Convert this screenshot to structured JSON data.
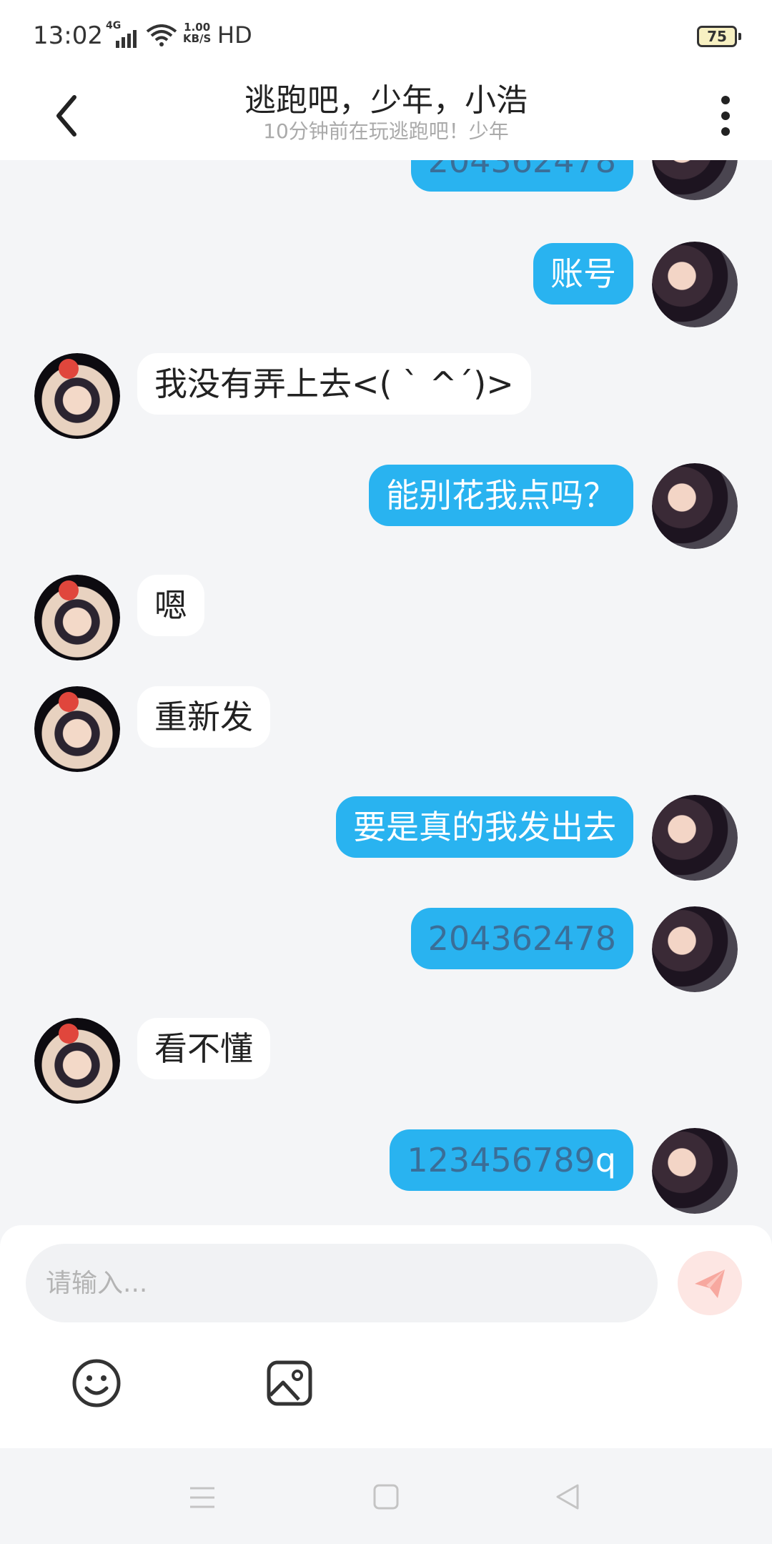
{
  "status_bar": {
    "time": "13:02",
    "network": "4G",
    "speed_value": "1.00",
    "speed_unit": "KB/S",
    "hd": "HD",
    "battery": "75"
  },
  "header": {
    "title": "逃跑吧，少年，小浩",
    "subtitle": "10分钟前在玩逃跑吧！少年"
  },
  "messages": [
    {
      "sender": "me",
      "text": "204362478"
    },
    {
      "sender": "me",
      "text": "账号"
    },
    {
      "sender": "them",
      "text": "我没有弄上去<( ` ^´)>"
    },
    {
      "sender": "me",
      "text": "能别花我点吗？"
    },
    {
      "sender": "them",
      "text": "嗯"
    },
    {
      "sender": "them",
      "text": "重新发"
    },
    {
      "sender": "me",
      "text": "要是真的我发出去"
    },
    {
      "sender": "me",
      "text": "204362478"
    },
    {
      "sender": "them",
      "text": "看不懂"
    },
    {
      "sender": "me",
      "text": "123456789",
      "suffix": "q"
    }
  ],
  "composer": {
    "placeholder": "请输入..."
  },
  "colors": {
    "my_bubble": "#29b3f0",
    "their_bubble": "#ffffff",
    "background": "#f4f5f7",
    "send_button": "#f48a7e"
  },
  "icons": [
    "back-arrow-icon",
    "more-vertical-icon",
    "send-icon",
    "emoji-icon",
    "image-icon",
    "nav-menu-icon",
    "nav-home-icon",
    "nav-back-icon"
  ]
}
